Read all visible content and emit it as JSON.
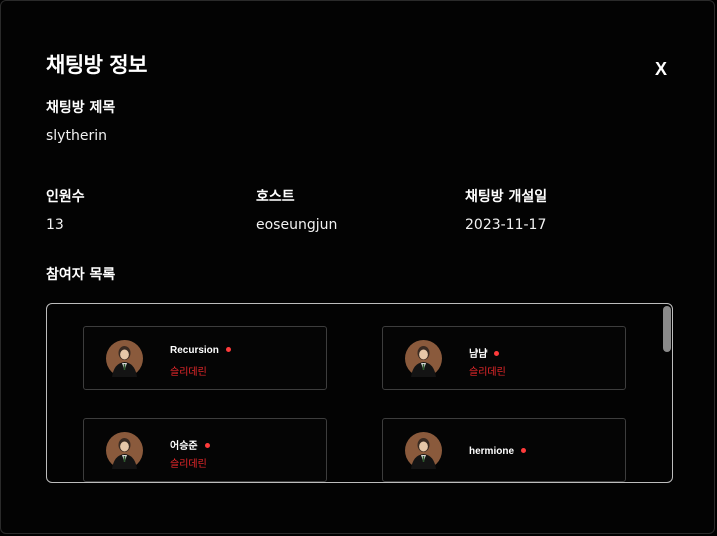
{
  "modal": {
    "title": "채팅방 정보",
    "close_label": "X"
  },
  "room": {
    "title_label": "채팅방 제목",
    "title_value": "slytherin",
    "members_label": "인원수",
    "members_value": "13",
    "host_label": "호스트",
    "host_value": "eoseungjun",
    "created_label": "채팅방 개설일",
    "created_value": "2023-11-17"
  },
  "participants": {
    "label": "참여자 목록",
    "users": [
      {
        "name": "Recursion",
        "house": "슬리데린",
        "online": true,
        "avatar": "avatar-icon"
      },
      {
        "name": "냠냠",
        "house": "슬리데린",
        "online": true,
        "avatar": "avatar-icon"
      },
      {
        "name": "어승준",
        "house": "슬리데린",
        "online": true,
        "avatar": "avatar-icon"
      },
      {
        "name": "hermione",
        "house": "",
        "online": true,
        "avatar": "avatar-icon"
      }
    ]
  },
  "colors": {
    "background": "#000000",
    "online_dot": "#ff3b3b",
    "house_text": "#e8282b",
    "card_border": "#3d3d3d",
    "box_border": "#bdbdbd"
  }
}
